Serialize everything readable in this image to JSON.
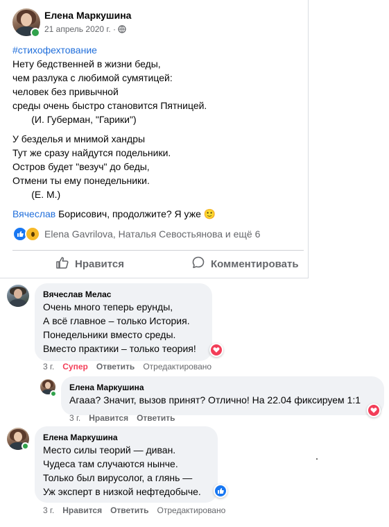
{
  "post": {
    "author": "Елена Маркушина",
    "date": "21 апрель 2020 г.",
    "privacy_separator": "·",
    "privacy_icon": "globe-icon",
    "hashtag": "#стихофехтование",
    "stanza1": [
      "Нету бедственней в жизни беды,",
      "чем разлука с любимой сумятицей:",
      "человек без привычной",
      "среды очень быстро становится Пятницей.",
      "       (И. Губерман, \"Гарики\")"
    ],
    "stanza2": [
      "У безделья и мнимой хандры",
      "Тут же сразу найдутся подельники.",
      "Остров будет \"везуч\" до беды,",
      "Отмени ты ему понедельники.",
      "       (Е. М.)"
    ],
    "mention_name": "Вячеслав",
    "mention_rest": " Борисович, продолжите? Я уже ",
    "emoji": "🙂",
    "reactions_text": "Elena Gavrilova, Наталья Севостьянова и ещё 6",
    "like_label": "Нравится",
    "comment_label": "Комментировать"
  },
  "comments": [
    {
      "author": "Вячеслав Мелас",
      "lines": [
        "Очень много теперь ерунды,",
        "А всё главное – только История.",
        "Понедельники вместо среды.",
        "Вместо практики – только теория!"
      ],
      "time": "3 г.",
      "reaction_label": "Супер",
      "reply_label": "Ответить",
      "edited": "Отредактировано"
    },
    {
      "author": "Елена Маркушина",
      "lines": [
        "Агааа? Значит, вызов принят? Отлично! На 22.04 фиксируем 1:1"
      ],
      "time": "3 г.",
      "like_label": "Нравится",
      "reply_label": "Ответить"
    },
    {
      "author": "Елена Маркушина",
      "lines": [
        "Место силы теорий — диван.",
        "Чудеса там случаются нынче.",
        "Только был вирусолог, а глянь —",
        "Уж эксперт в низкой нефтедобыче."
      ],
      "time": "3 г.",
      "like_label": "Нравится",
      "reply_label": "Ответить",
      "edited": "Отредактировано"
    }
  ],
  "colors": {
    "link": "#216fdb",
    "muted": "#65676b",
    "bubble": "#f0f2f5",
    "like_blue": "#1877f2",
    "love_red": "#f33e58",
    "online_green": "#31a24c"
  }
}
